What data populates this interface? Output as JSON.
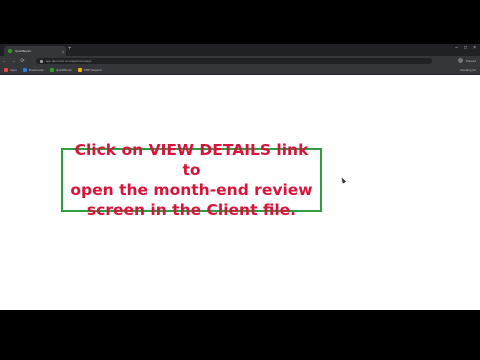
{
  "browser": {
    "tab_title": "QuickBooks",
    "tab_close": "×",
    "new_tab": "+",
    "url": "app.qbo.intuit.com/app/homepage",
    "profile_label": "Paused",
    "window_controls": [
      "–",
      "□",
      "×"
    ],
    "nav": [
      "←",
      "→",
      "⟳"
    ]
  },
  "bookmarks": {
    "items": [
      {
        "label": "Apps",
        "color": "#e8453c"
      },
      {
        "label": "Bookmarks",
        "color": "#2f7de1"
      },
      {
        "label": "QuickBooks",
        "color": "#2ca01c"
      },
      {
        "label": "PBP Network",
        "color": "#f4b400"
      },
      {
        "label": "",
        "color": "#888888"
      }
    ],
    "reading_list": "Reading list"
  },
  "callout": {
    "line1": "Click on VIEW DETAILS link to",
    "line2": "open the month-end review",
    "line3": "screen in the Client file.",
    "text_color": "#d9143a",
    "border_color": "#2e9e3c"
  }
}
